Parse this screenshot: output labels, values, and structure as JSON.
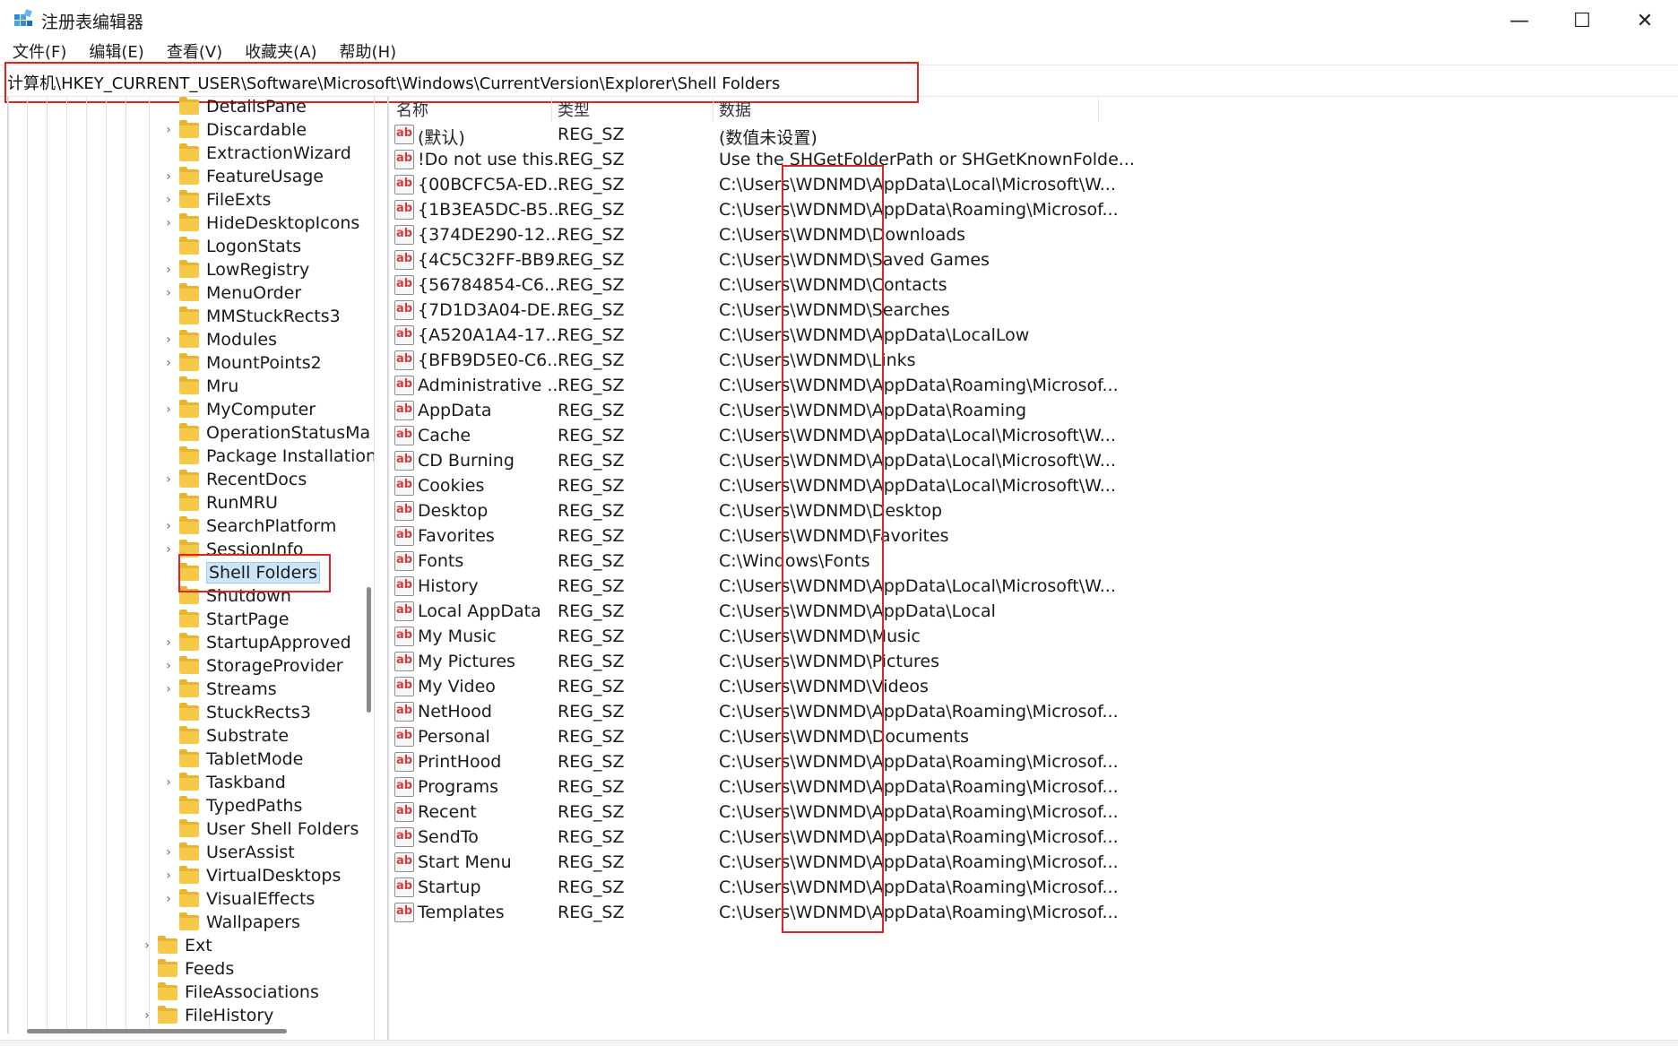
{
  "window": {
    "title": "注册表编辑器",
    "minimize": "—",
    "maximize": "☐",
    "close": "✕"
  },
  "menu": [
    "文件(F)",
    "编辑(E)",
    "查看(V)",
    "收藏夹(A)",
    "帮助(H)"
  ],
  "address": "计算机\\HKEY_CURRENT_USER\\Software\\Microsoft\\Windows\\CurrentVersion\\Explorer\\Shell Folders",
  "tree": [
    {
      "label": "DetailsPane",
      "expandable": false,
      "level": 2
    },
    {
      "label": "Discardable",
      "expandable": true,
      "level": 2
    },
    {
      "label": "ExtractionWizard",
      "expandable": false,
      "level": 2
    },
    {
      "label": "FeatureUsage",
      "expandable": true,
      "level": 2
    },
    {
      "label": "FileExts",
      "expandable": true,
      "level": 2
    },
    {
      "label": "HideDesktopIcons",
      "expandable": true,
      "level": 2
    },
    {
      "label": "LogonStats",
      "expandable": false,
      "level": 2
    },
    {
      "label": "LowRegistry",
      "expandable": true,
      "level": 2
    },
    {
      "label": "MenuOrder",
      "expandable": true,
      "level": 2
    },
    {
      "label": "MMStuckRects3",
      "expandable": false,
      "level": 2
    },
    {
      "label": "Modules",
      "expandable": true,
      "level": 2
    },
    {
      "label": "MountPoints2",
      "expandable": true,
      "level": 2
    },
    {
      "label": "Mru",
      "expandable": false,
      "level": 2
    },
    {
      "label": "MyComputer",
      "expandable": true,
      "level": 2
    },
    {
      "label": "OperationStatusMa",
      "expandable": false,
      "level": 2
    },
    {
      "label": "Package Installation",
      "expandable": false,
      "level": 2
    },
    {
      "label": "RecentDocs",
      "expandable": true,
      "level": 2
    },
    {
      "label": "RunMRU",
      "expandable": false,
      "level": 2
    },
    {
      "label": "SearchPlatform",
      "expandable": true,
      "level": 2
    },
    {
      "label": "SessionInfo",
      "expandable": true,
      "level": 2
    },
    {
      "label": "Shell Folders",
      "expandable": false,
      "level": 2,
      "selected": true
    },
    {
      "label": "Shutdown",
      "expandable": false,
      "level": 2
    },
    {
      "label": "StartPage",
      "expandable": false,
      "level": 2
    },
    {
      "label": "StartupApproved",
      "expandable": true,
      "level": 2
    },
    {
      "label": "StorageProvider",
      "expandable": true,
      "level": 2
    },
    {
      "label": "Streams",
      "expandable": true,
      "level": 2
    },
    {
      "label": "StuckRects3",
      "expandable": false,
      "level": 2
    },
    {
      "label": "Substrate",
      "expandable": false,
      "level": 2
    },
    {
      "label": "TabletMode",
      "expandable": false,
      "level": 2
    },
    {
      "label": "Taskband",
      "expandable": true,
      "level": 2
    },
    {
      "label": "TypedPaths",
      "expandable": false,
      "level": 2
    },
    {
      "label": "User Shell Folders",
      "expandable": false,
      "level": 2
    },
    {
      "label": "UserAssist",
      "expandable": true,
      "level": 2
    },
    {
      "label": "VirtualDesktops",
      "expandable": true,
      "level": 2
    },
    {
      "label": "VisualEffects",
      "expandable": true,
      "level": 2
    },
    {
      "label": "Wallpapers",
      "expandable": false,
      "level": 2
    },
    {
      "label": "Ext",
      "expandable": true,
      "level": 1
    },
    {
      "label": "Feeds",
      "expandable": false,
      "level": 1
    },
    {
      "label": "FileAssociations",
      "expandable": false,
      "level": 1
    },
    {
      "label": "FileHistory",
      "expandable": true,
      "level": 1
    }
  ],
  "columns": {
    "name": "名称",
    "type": "类型",
    "data": "数据"
  },
  "values": [
    {
      "name": "(默认)",
      "type": "REG_SZ",
      "data": "(数值未设置)"
    },
    {
      "name": "!Do not use this...",
      "type": "REG_SZ",
      "data": "Use the SHGetFolderPath or SHGetKnownFolde..."
    },
    {
      "name": "{00BCFC5A-ED...",
      "type": "REG_SZ",
      "data": "C:\\Users\\WDNMD\\AppData\\Local\\Microsoft\\W..."
    },
    {
      "name": "{1B3EA5DC-B5...",
      "type": "REG_SZ",
      "data": "C:\\Users\\WDNMD\\AppData\\Roaming\\Microsof..."
    },
    {
      "name": "{374DE290-12...",
      "type": "REG_SZ",
      "data": "C:\\Users\\WDNMD\\Downloads"
    },
    {
      "name": "{4C5C32FF-BB9...",
      "type": "REG_SZ",
      "data": "C:\\Users\\WDNMD\\Saved Games"
    },
    {
      "name": "{56784854-C6...",
      "type": "REG_SZ",
      "data": "C:\\Users\\WDNMD\\Contacts"
    },
    {
      "name": "{7D1D3A04-DE...",
      "type": "REG_SZ",
      "data": "C:\\Users\\WDNMD\\Searches"
    },
    {
      "name": "{A520A1A4-17...",
      "type": "REG_SZ",
      "data": "C:\\Users\\WDNMD\\AppData\\LocalLow"
    },
    {
      "name": "{BFB9D5E0-C6...",
      "type": "REG_SZ",
      "data": "C:\\Users\\WDNMD\\Links"
    },
    {
      "name": "Administrative ...",
      "type": "REG_SZ",
      "data": "C:\\Users\\WDNMD\\AppData\\Roaming\\Microsof..."
    },
    {
      "name": "AppData",
      "type": "REG_SZ",
      "data": "C:\\Users\\WDNMD\\AppData\\Roaming"
    },
    {
      "name": "Cache",
      "type": "REG_SZ",
      "data": "C:\\Users\\WDNMD\\AppData\\Local\\Microsoft\\W..."
    },
    {
      "name": "CD Burning",
      "type": "REG_SZ",
      "data": "C:\\Users\\WDNMD\\AppData\\Local\\Microsoft\\W..."
    },
    {
      "name": "Cookies",
      "type": "REG_SZ",
      "data": "C:\\Users\\WDNMD\\AppData\\Local\\Microsoft\\W..."
    },
    {
      "name": "Desktop",
      "type": "REG_SZ",
      "data": "C:\\Users\\WDNMD\\Desktop"
    },
    {
      "name": "Favorites",
      "type": "REG_SZ",
      "data": "C:\\Users\\WDNMD\\Favorites"
    },
    {
      "name": "Fonts",
      "type": "REG_SZ",
      "data": "C:\\Windows\\Fonts"
    },
    {
      "name": "History",
      "type": "REG_SZ",
      "data": "C:\\Users\\WDNMD\\AppData\\Local\\Microsoft\\W..."
    },
    {
      "name": "Local AppData",
      "type": "REG_SZ",
      "data": "C:\\Users\\WDNMD\\AppData\\Local"
    },
    {
      "name": "My Music",
      "type": "REG_SZ",
      "data": "C:\\Users\\WDNMD\\Music"
    },
    {
      "name": "My Pictures",
      "type": "REG_SZ",
      "data": "C:\\Users\\WDNMD\\Pictures"
    },
    {
      "name": "My Video",
      "type": "REG_SZ",
      "data": "C:\\Users\\WDNMD\\Videos"
    },
    {
      "name": "NetHood",
      "type": "REG_SZ",
      "data": "C:\\Users\\WDNMD\\AppData\\Roaming\\Microsof..."
    },
    {
      "name": "Personal",
      "type": "REG_SZ",
      "data": "C:\\Users\\WDNMD\\Documents"
    },
    {
      "name": "PrintHood",
      "type": "REG_SZ",
      "data": "C:\\Users\\WDNMD\\AppData\\Roaming\\Microsof..."
    },
    {
      "name": "Programs",
      "type": "REG_SZ",
      "data": "C:\\Users\\WDNMD\\AppData\\Roaming\\Microsof..."
    },
    {
      "name": "Recent",
      "type": "REG_SZ",
      "data": "C:\\Users\\WDNMD\\AppData\\Roaming\\Microsof..."
    },
    {
      "name": "SendTo",
      "type": "REG_SZ",
      "data": "C:\\Users\\WDNMD\\AppData\\Roaming\\Microsof..."
    },
    {
      "name": "Start Menu",
      "type": "REG_SZ",
      "data": "C:\\Users\\WDNMD\\AppData\\Roaming\\Microsof..."
    },
    {
      "name": "Startup",
      "type": "REG_SZ",
      "data": "C:\\Users\\WDNMD\\AppData\\Roaming\\Microsof..."
    },
    {
      "name": "Templates",
      "type": "REG_SZ",
      "data": "C:\\Users\\WDNMD\\AppData\\Roaming\\Microsof..."
    }
  ],
  "value_icon": "ab",
  "colors": {
    "highlight": "#e52222",
    "selection": "#cce4f7",
    "folder": "#f7c948"
  }
}
